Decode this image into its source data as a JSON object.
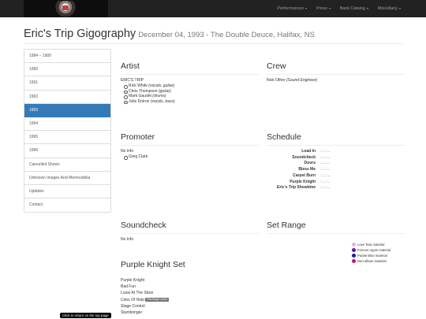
{
  "navbar": {
    "logo_name": "band-logo",
    "items": [
      {
        "label": "Performances"
      },
      {
        "label": "Press"
      },
      {
        "label": "Back Catalog"
      },
      {
        "label": "Miscellany"
      }
    ]
  },
  "page": {
    "title": "Eric's Trip Gigography",
    "subtitle": "December 04, 1993 - The Double Deuce, Halifax, NS"
  },
  "sidebar": {
    "items": [
      {
        "label": "1984 – 1989"
      },
      {
        "label": "1990"
      },
      {
        "label": "1991"
      },
      {
        "label": "1992"
      },
      {
        "label": "1993",
        "active": true
      },
      {
        "label": "1994"
      },
      {
        "label": "1995"
      },
      {
        "label": "1996"
      },
      {
        "label": "Cancelled Shows"
      },
      {
        "label": "Unknown Images And Memorabilia"
      },
      {
        "label": "Updates"
      },
      {
        "label": "Contact"
      }
    ]
  },
  "artist": {
    "heading": "Artist",
    "band": "ERIC'S TRIP",
    "members": [
      {
        "name": "Rick White",
        "role": "(vocals, guitar)"
      },
      {
        "name": "Chris Thompson",
        "role": "(guitar)"
      },
      {
        "name": "Mark Gaudet",
        "role": "(drums)"
      },
      {
        "name": "Julie Doiron",
        "role": "(vocals, bass)"
      }
    ]
  },
  "crew": {
    "heading": "Crew",
    "name": "Nick Other",
    "role": "(Sound Engineer)"
  },
  "promoter": {
    "heading": "Promoter",
    "info": "No Info",
    "people": [
      "Greg Clark"
    ]
  },
  "schedule": {
    "heading": "Schedule",
    "rows": [
      {
        "label": "Load In",
        "value": ":..:..:.."
      },
      {
        "label": "Soundcheck",
        "value": ":..:..:.."
      },
      {
        "label": "Doors",
        "value": ":..:..:.."
      },
      {
        "label": "Bless Me",
        "value": ":..:..:.."
      },
      {
        "label": "Carpet Burn",
        "value": ":..:..:.."
      },
      {
        "label": "Purple Knight",
        "value": ":..:..:.."
      },
      {
        "label": "Eric's Trip Showtime",
        "value": ":..:..:.."
      }
    ]
  },
  "soundcheck": {
    "heading": "Soundcheck",
    "info": "No Info"
  },
  "set_range": {
    "heading": "Set Range",
    "legend": [
      {
        "label": "Love Tara material",
        "color": "#c8c8c8"
      },
      {
        "label": "Forever Again material",
        "color": "#6a0dad"
      },
      {
        "label": "Purple Blue material",
        "color": "#1a1aa6"
      },
      {
        "label": "Non-album material",
        "color": "#c2185b"
      }
    ]
  },
  "purple_knight_set": {
    "heading": "Purple Knight Set",
    "songs": [
      {
        "title": "Purple Knight"
      },
      {
        "title": "Bad Fun"
      },
      {
        "title": "Louie At The Store"
      },
      {
        "title": "Cries Of Help",
        "tag": "Discharge cover"
      },
      {
        "title": "Stage Control"
      },
      {
        "title": "Stumbringer"
      }
    ]
  },
  "tooltip": {
    "text": "Click to return on the top page"
  }
}
